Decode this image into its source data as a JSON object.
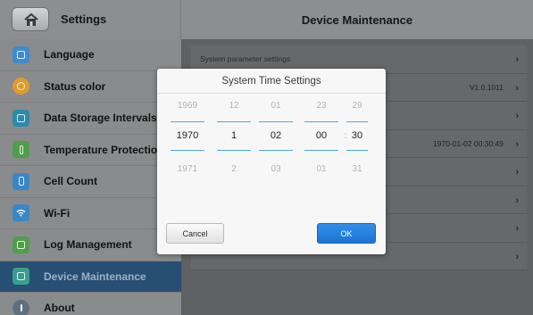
{
  "header": {
    "left_title": "Settings",
    "right_title": "Device Maintenance"
  },
  "sidebar": {
    "items": [
      {
        "label": "Language",
        "icon": "language-icon",
        "color": "#3f8ad0",
        "active": false
      },
      {
        "label": "Status color",
        "icon": "palette-icon",
        "color": "#e09b2e",
        "active": false
      },
      {
        "label": "Data Storage Intervals",
        "icon": "storage-icon",
        "color": "#2d8aa8",
        "active": false
      },
      {
        "label": "Temperature Protection",
        "icon": "thermometer-icon",
        "color": "#4f9e4a",
        "active": false
      },
      {
        "label": "Cell Count",
        "icon": "battery-icon",
        "color": "#3a87c7",
        "active": false
      },
      {
        "label": "Wi-Fi",
        "icon": "wifi-icon",
        "color": "#3a87c7",
        "active": false
      },
      {
        "label": "Log Management",
        "icon": "log-icon",
        "color": "#4f9e4a",
        "active": false
      },
      {
        "label": "Device Maintenance",
        "icon": "maintenance-icon",
        "color": "#3a9d8e",
        "active": true
      },
      {
        "label": "About",
        "icon": "info-icon",
        "color": "#5f6f80",
        "active": false
      }
    ]
  },
  "main": {
    "rows": [
      {
        "name": "System parameter settings",
        "value": ""
      },
      {
        "name": "",
        "value": "V1.0.1011"
      },
      {
        "name": "",
        "value": ""
      },
      {
        "name": "",
        "value": "1970-01-02 00:30:49"
      },
      {
        "name": "",
        "value": ""
      },
      {
        "name": "",
        "value": ""
      },
      {
        "name": "",
        "value": ""
      },
      {
        "name": "",
        "value": ""
      }
    ]
  },
  "dialog": {
    "title": "System Time Settings",
    "columns": [
      {
        "prev": "1969",
        "current": "1970",
        "next": "1971"
      },
      {
        "prev": "12",
        "current": "1",
        "next": "2"
      },
      {
        "prev": "01",
        "current": "02",
        "next": "03"
      },
      {
        "prev": "23",
        "current": "00",
        "next": "01"
      },
      {
        "prev": "29",
        "current": "30",
        "next": "31"
      }
    ],
    "separator": ":",
    "cancel_label": "Cancel",
    "ok_label": "OK"
  }
}
